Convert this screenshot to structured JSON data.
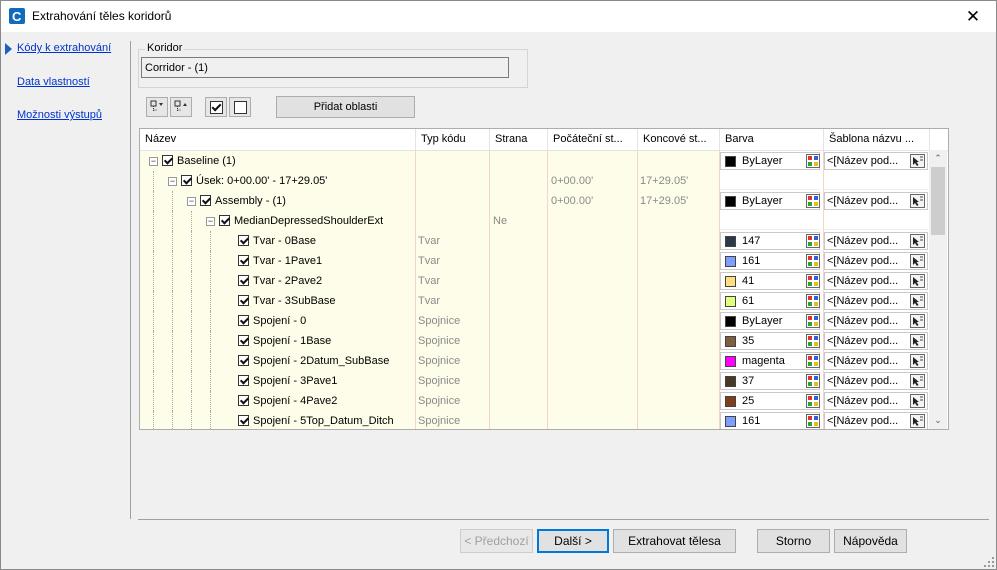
{
  "window": {
    "title": "Extrahování těles koridorů",
    "close_glyph": "✕"
  },
  "nav": {
    "items": [
      {
        "label": "Kódy k extrahování",
        "selected": true
      },
      {
        "label": "Data vlastností",
        "selected": false
      },
      {
        "label": "Možnosti výstupů",
        "selected": false
      }
    ]
  },
  "corridor": {
    "group_label": "Koridor",
    "value": "Corridor - (1)"
  },
  "toolbar": {
    "add_areas_label": "Přidat oblasti"
  },
  "grid": {
    "columns": [
      "Název",
      "Typ kódu",
      "Strana",
      "Počáteční st...",
      "Koncové st...",
      "Barva",
      "Šablona názvu ..."
    ],
    "rows": [
      {
        "name": "Baseline (1)",
        "level": 0,
        "expander": "−",
        "code_type": "",
        "side": "",
        "start": "",
        "end": "",
        "color": {
          "label": "ByLayer",
          "swatch": "#000000"
        },
        "template": "<[Název pod..."
      },
      {
        "name": "Úsek: 0+00.00' - 17+29.05'",
        "level": 1,
        "expander": "−",
        "code_type": "",
        "side": "",
        "start": "0+00.00'",
        "end": "17+29.05'",
        "color": null,
        "template": ""
      },
      {
        "name": "Assembly - (1)",
        "level": 2,
        "expander": "−",
        "code_type": "",
        "side": "",
        "start": "0+00.00'",
        "end": "17+29.05'",
        "color": {
          "label": "ByLayer",
          "swatch": "#000000"
        },
        "template": "<[Název pod..."
      },
      {
        "name": "MedianDepressedShoulderExt",
        "level": 3,
        "expander": "−",
        "code_type": "",
        "side": "Ne",
        "start": "",
        "end": "",
        "color": null,
        "template": ""
      },
      {
        "name": "Tvar - 0Base",
        "level": 4,
        "expander": "",
        "code_type": "Tvar",
        "side": "",
        "start": "",
        "end": "",
        "color": {
          "label": "147",
          "swatch": "#2c3a48"
        },
        "template": "<[Název pod..."
      },
      {
        "name": "Tvar - 1Pave1",
        "level": 4,
        "expander": "",
        "code_type": "Tvar",
        "side": "",
        "start": "",
        "end": "",
        "color": {
          "label": "161",
          "swatch": "#7f9fff"
        },
        "template": "<[Název pod..."
      },
      {
        "name": "Tvar - 2Pave2",
        "level": 4,
        "expander": "",
        "code_type": "Tvar",
        "side": "",
        "start": "",
        "end": "",
        "color": {
          "label": "41",
          "swatch": "#ffdf7f"
        },
        "template": "<[Název pod..."
      },
      {
        "name": "Tvar - 3SubBase",
        "level": 4,
        "expander": "",
        "code_type": "Tvar",
        "side": "",
        "start": "",
        "end": "",
        "color": {
          "label": "61",
          "swatch": "#dfff7f"
        },
        "template": "<[Název pod..."
      },
      {
        "name": "Spojení - 0",
        "level": 4,
        "expander": "",
        "code_type": "Spojnice",
        "side": "",
        "start": "",
        "end": "",
        "color": {
          "label": "ByLayer",
          "swatch": "#000000"
        },
        "template": "<[Název pod..."
      },
      {
        "name": "Spojení - 1Base",
        "level": 4,
        "expander": "",
        "code_type": "Spojnice",
        "side": "",
        "start": "",
        "end": "",
        "color": {
          "label": "35",
          "swatch": "#7f5f3f"
        },
        "template": "<[Název pod..."
      },
      {
        "name": "Spojení - 2Datum_SubBase",
        "level": 4,
        "expander": "",
        "code_type": "Spojnice",
        "side": "",
        "start": "",
        "end": "",
        "color": {
          "label": "magenta",
          "swatch": "#ff00ff"
        },
        "template": "<[Název pod..."
      },
      {
        "name": "Spojení - 3Pave1",
        "level": 4,
        "expander": "",
        "code_type": "Spojnice",
        "side": "",
        "start": "",
        "end": "",
        "color": {
          "label": "37",
          "swatch": "#4c3924"
        },
        "template": "<[Název pod..."
      },
      {
        "name": "Spojení - 4Pave2",
        "level": 4,
        "expander": "",
        "code_type": "Spojnice",
        "side": "",
        "start": "",
        "end": "",
        "color": {
          "label": "25",
          "swatch": "#7f3f1f"
        },
        "template": "<[Název pod..."
      },
      {
        "name": "Spojení - 5Top_Datum_Ditch",
        "level": 4,
        "expander": "",
        "code_type": "Spojnice",
        "side": "",
        "start": "",
        "end": "",
        "color": {
          "label": "161",
          "swatch": "#7f9fff"
        },
        "template": "<[Název pod..."
      }
    ]
  },
  "scrollbar": {
    "up_glyph": "⌃",
    "down_glyph": "⌄"
  },
  "buttons": {
    "prev": "< Předchozí",
    "next": "Další >",
    "extract": "Extrahovat tělesa",
    "cancel": "Storno",
    "help": "Nápověda"
  },
  "colors": {
    "accent": "#0078d7",
    "link": "#0033cc",
    "cell_bg": "#fdfde9"
  }
}
